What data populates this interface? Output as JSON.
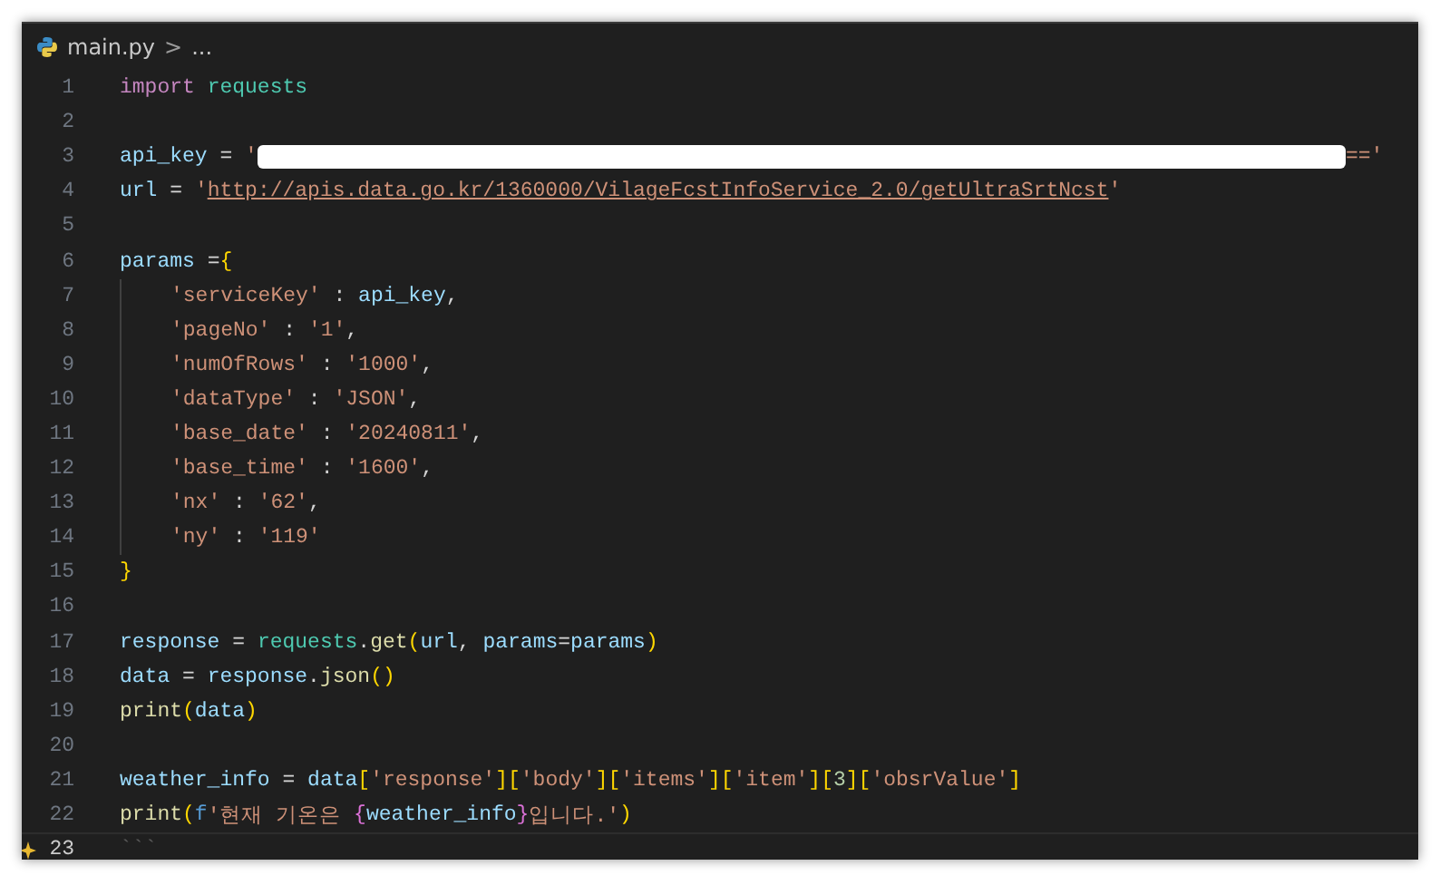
{
  "breadcrumb": {
    "file": "main.py",
    "separator": ">",
    "more": "..."
  },
  "lines": [
    {
      "number": "1",
      "current": false,
      "tokens": [
        {
          "text": "import ",
          "kind": "keyword"
        },
        {
          "text": "requests",
          "kind": "module"
        }
      ]
    },
    {
      "number": "2",
      "current": false
    },
    {
      "number": "3",
      "current": false,
      "tokens": [
        {
          "text": "api_key",
          "kind": "variable"
        },
        {
          "text": " = ",
          "kind": "plain"
        },
        {
          "text": "'",
          "kind": "string"
        },
        {
          "kind": "redaction"
        },
        {
          "text": "=='",
          "kind": "string"
        }
      ]
    },
    {
      "number": "4",
      "current": false,
      "tokens": [
        {
          "text": "url",
          "kind": "variable"
        },
        {
          "text": " = ",
          "kind": "plain"
        },
        {
          "text": "'",
          "kind": "string"
        },
        {
          "text": "http://apis.data.go.kr/1360000/VilageFcstInfoService_2.0/getUltraSrtNcst",
          "kind": "link"
        },
        {
          "text": "'",
          "kind": "string"
        }
      ]
    },
    {
      "number": "5",
      "current": false
    },
    {
      "number": "6",
      "current": false,
      "tokens": [
        {
          "text": "params",
          "kind": "variable"
        },
        {
          "text": " =",
          "kind": "plain"
        },
        {
          "text": "{",
          "kind": "bracket1"
        }
      ],
      "children": [
        {
          "number": "7",
          "current": false,
          "tokens": [
            {
              "text": "'serviceKey'",
              "kind": "string"
            },
            {
              "text": " : ",
              "kind": "plain"
            },
            {
              "text": "api_key",
              "kind": "variable"
            },
            {
              "text": ",",
              "kind": "plain"
            }
          ]
        },
        {
          "number": "8",
          "current": false,
          "tokens": [
            {
              "text": "'pageNo'",
              "kind": "string"
            },
            {
              "text": " : ",
              "kind": "plain"
            },
            {
              "text": "'1'",
              "kind": "string"
            },
            {
              "text": ",",
              "kind": "plain"
            }
          ]
        },
        {
          "number": "9",
          "current": false,
          "tokens": [
            {
              "text": "'numOfRows'",
              "kind": "string"
            },
            {
              "text": " : ",
              "kind": "plain"
            },
            {
              "text": "'1000'",
              "kind": "string"
            },
            {
              "text": ",",
              "kind": "plain"
            }
          ]
        },
        {
          "number": "10",
          "current": false,
          "tokens": [
            {
              "text": "'dataType'",
              "kind": "string"
            },
            {
              "text": " : ",
              "kind": "plain"
            },
            {
              "text": "'JSON'",
              "kind": "string"
            },
            {
              "text": ",",
              "kind": "plain"
            }
          ]
        },
        {
          "number": "11",
          "current": false,
          "tokens": [
            {
              "text": "'base_date'",
              "kind": "string"
            },
            {
              "text": " : ",
              "kind": "plain"
            },
            {
              "text": "'20240811'",
              "kind": "string"
            },
            {
              "text": ",",
              "kind": "plain"
            }
          ]
        },
        {
          "number": "12",
          "current": false,
          "tokens": [
            {
              "text": "'base_time'",
              "kind": "string"
            },
            {
              "text": " : ",
              "kind": "plain"
            },
            {
              "text": "'1600'",
              "kind": "string"
            },
            {
              "text": ",",
              "kind": "plain"
            }
          ]
        },
        {
          "number": "13",
          "current": false,
          "tokens": [
            {
              "text": "'nx'",
              "kind": "string"
            },
            {
              "text": " : ",
              "kind": "plain"
            },
            {
              "text": "'62'",
              "kind": "string"
            },
            {
              "text": ",",
              "kind": "plain"
            }
          ]
        },
        {
          "number": "14",
          "current": false,
          "tokens": [
            {
              "text": "'ny'",
              "kind": "string"
            },
            {
              "text": " : ",
              "kind": "plain"
            },
            {
              "text": "'119'",
              "kind": "string"
            }
          ]
        }
      ]
    },
    {
      "number": "15",
      "current": false,
      "tokens": [
        {
          "text": "}",
          "kind": "bracket1"
        }
      ]
    },
    {
      "number": "16",
      "current": false
    },
    {
      "number": "17",
      "current": false,
      "tokens": [
        {
          "text": "response",
          "kind": "variable"
        },
        {
          "text": " = ",
          "kind": "plain"
        },
        {
          "text": "requests",
          "kind": "module"
        },
        {
          "text": ".",
          "kind": "plain"
        },
        {
          "text": "get",
          "kind": "function"
        },
        {
          "text": "(",
          "kind": "bracket1"
        },
        {
          "text": "url",
          "kind": "variable"
        },
        {
          "text": ", ",
          "kind": "plain"
        },
        {
          "text": "params",
          "kind": "variable"
        },
        {
          "text": "=",
          "kind": "plain"
        },
        {
          "text": "params",
          "kind": "variable"
        },
        {
          "text": ")",
          "kind": "bracket1"
        }
      ]
    },
    {
      "number": "18",
      "current": false,
      "tokens": [
        {
          "text": "data",
          "kind": "variable"
        },
        {
          "text": " = ",
          "kind": "plain"
        },
        {
          "text": "response",
          "kind": "variable"
        },
        {
          "text": ".",
          "kind": "plain"
        },
        {
          "text": "json",
          "kind": "function"
        },
        {
          "text": "()",
          "kind": "bracket1"
        }
      ]
    },
    {
      "number": "19",
      "current": false,
      "tokens": [
        {
          "text": "print",
          "kind": "function"
        },
        {
          "text": "(",
          "kind": "bracket1"
        },
        {
          "text": "data",
          "kind": "variable"
        },
        {
          "text": ")",
          "kind": "bracket1"
        }
      ]
    },
    {
      "number": "20",
      "current": false
    },
    {
      "number": "21",
      "current": false,
      "tokens": [
        {
          "text": "weather_info",
          "kind": "variable"
        },
        {
          "text": " = ",
          "kind": "plain"
        },
        {
          "text": "data",
          "kind": "variable"
        },
        {
          "text": "[",
          "kind": "bracket1"
        },
        {
          "text": "'response'",
          "kind": "string"
        },
        {
          "text": "][",
          "kind": "bracket1"
        },
        {
          "text": "'body'",
          "kind": "string"
        },
        {
          "text": "][",
          "kind": "bracket1"
        },
        {
          "text": "'items'",
          "kind": "string"
        },
        {
          "text": "][",
          "kind": "bracket1"
        },
        {
          "text": "'item'",
          "kind": "string"
        },
        {
          "text": "][",
          "kind": "bracket1"
        },
        {
          "text": "3",
          "kind": "number"
        },
        {
          "text": "][",
          "kind": "bracket1"
        },
        {
          "text": "'obsrValue'",
          "kind": "string"
        },
        {
          "text": "]",
          "kind": "bracket1"
        }
      ]
    },
    {
      "number": "22",
      "current": false,
      "tokens": [
        {
          "text": "print",
          "kind": "function"
        },
        {
          "text": "(",
          "kind": "bracket1"
        },
        {
          "text": "f",
          "kind": "fprefix"
        },
        {
          "text": "'현재 기온은 ",
          "kind": "string"
        },
        {
          "text": "{",
          "kind": "bracket2"
        },
        {
          "text": "weather_info",
          "kind": "variable"
        },
        {
          "text": "}",
          "kind": "bracket2"
        },
        {
          "text": "입니다.'",
          "kind": "string"
        },
        {
          "text": ")",
          "kind": "bracket1"
        }
      ]
    },
    {
      "number": "23",
      "current": true,
      "tokens": [
        {
          "text": "```",
          "kind": "ghost"
        }
      ]
    }
  ]
}
